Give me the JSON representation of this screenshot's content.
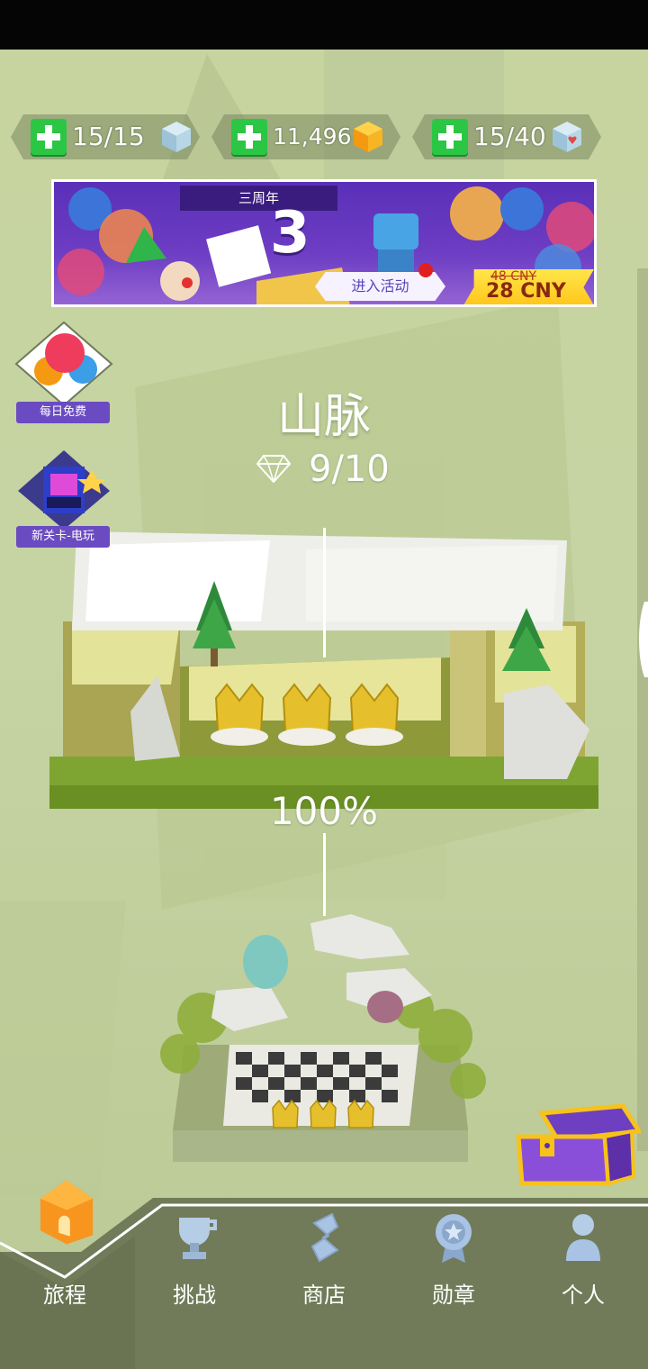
{
  "resources": [
    {
      "value": "15/15",
      "cube": "ice-cube-icon"
    },
    {
      "value": "11,496",
      "cube": "gold-cube-icon"
    },
    {
      "value": "15/40",
      "cube": "heart-cube-icon"
    }
  ],
  "banner": {
    "anniversary": "三周年",
    "number": "3",
    "enter": "进入活动",
    "old_price": "48 CNY",
    "new_price": "28 CNY"
  },
  "side": {
    "daily": "每日免费",
    "new_level": "新关卡-电玩"
  },
  "level": {
    "title": "山脉",
    "gems": "9/10",
    "progress": "100%"
  },
  "nav": {
    "journey": "旅程",
    "challenge": "挑战",
    "shop": "商店",
    "medal": "勋章",
    "profile": "个人"
  },
  "colors": {
    "background": "#c7d4a0",
    "plus_green": "#2cc645",
    "banner_purple": "#5a2fb8",
    "nav_dark": "#6f7a58",
    "house_orange": "#f7951f"
  }
}
